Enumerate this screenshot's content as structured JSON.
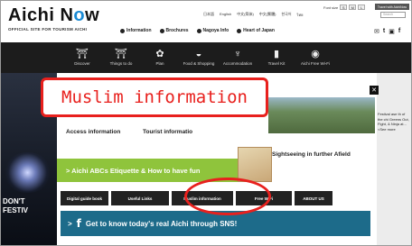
{
  "header": {
    "logo_prefix": "Aichi N",
    "logo_o": "o",
    "logo_suffix": "w",
    "tagline": "OFFICIAL SITE FOR TOURISM AICHI",
    "top_links": [
      "Information",
      "Brochures",
      "Nagoya Info",
      "Heart of Japan"
    ],
    "languages": [
      "日本語",
      "English",
      "中文(简体)",
      "中文(繁體)",
      "한국어",
      "ไทย"
    ],
    "font_size_label": "Font size",
    "font_sizes": [
      "S",
      "M",
      "L"
    ],
    "travel_button": "Travel with AichiNow",
    "search_placeholder": "Search",
    "social": [
      "✉",
      "t",
      "▣",
      "f"
    ]
  },
  "nav": {
    "items": [
      {
        "label": "Discover",
        "icon": "⛩"
      },
      {
        "label": "Things to do",
        "icon": "⛩"
      },
      {
        "label": "Plan",
        "icon": "✿"
      },
      {
        "label": "Food & Shopping",
        "icon": "◒"
      },
      {
        "label": "Accommodation",
        "icon": "♆"
      },
      {
        "label": "Travel Kit",
        "icon": "▮"
      },
      {
        "label": "Aichi Free Wi-Fi",
        "icon": "◉"
      }
    ]
  },
  "background": {
    "left_text_line1": "DON'T",
    "left_text_line2": "FESTIV",
    "right_text": "Festival ase th of the chi Greens Out, Fight, & Ninja at... <See more"
  },
  "modal": {
    "access_label": "Access information",
    "tourist_label": "Tourist informatio",
    "sightseeing_label": "Sightseeing in further Afield",
    "green_banner": "> Aichi ABCs Etiquette & How to have fun",
    "buttons": [
      "Digital guide book",
      "Useful Links",
      "Muslim information",
      "Free WiFi",
      "ABOUT US"
    ],
    "teal_banner": "Get to know today's real Aichi through SNS!"
  },
  "annotation": {
    "callout_text": "Muslim information"
  },
  "colors": {
    "accent_blue": "#1a8ad4",
    "nav_bg": "#1c1c1c",
    "green_banner": "#8fc43c",
    "teal_banner": "#1d6b8a",
    "annotation_red": "#e8201d"
  }
}
